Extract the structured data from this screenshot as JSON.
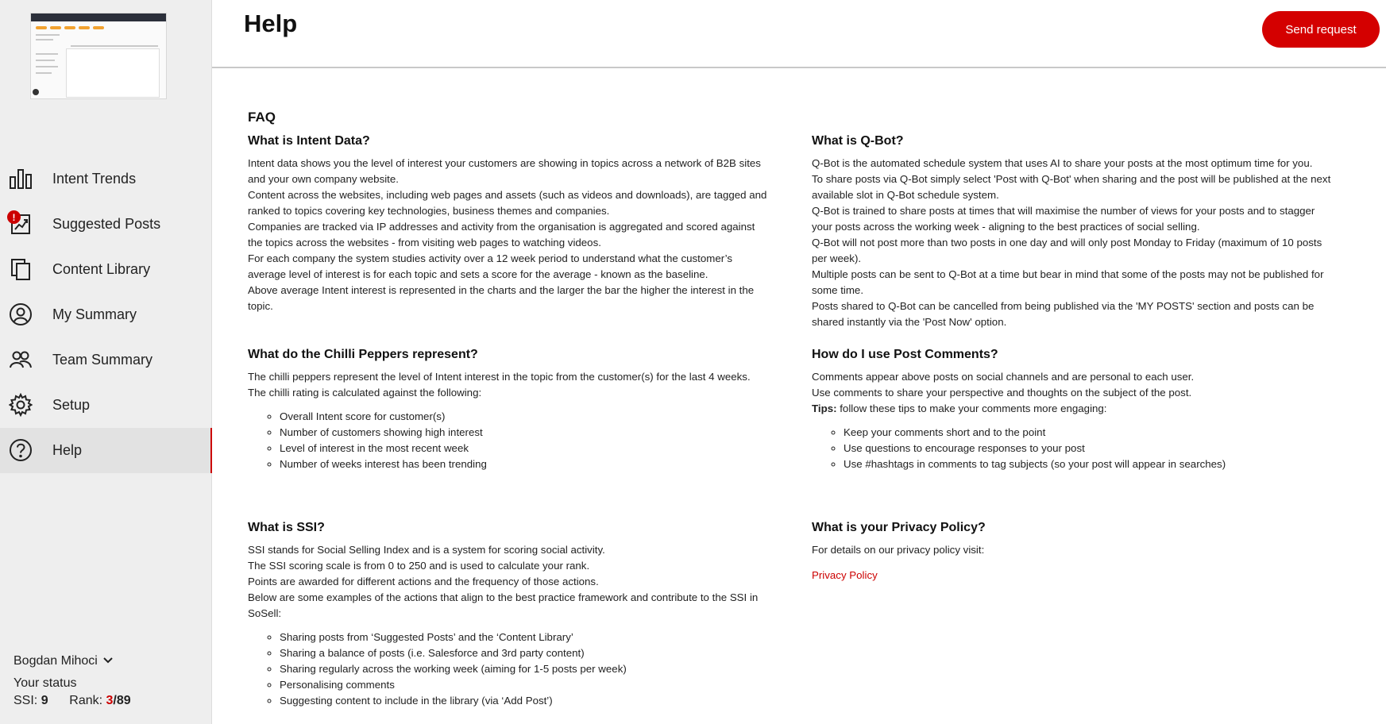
{
  "sidebar": {
    "items": [
      {
        "label": "Intent Trends",
        "icon": "bar-chart-icon"
      },
      {
        "label": "Suggested Posts",
        "icon": "trending-chart-icon",
        "badge": "!"
      },
      {
        "label": "Content Library",
        "icon": "copy-documents-icon"
      },
      {
        "label": "My Summary",
        "icon": "user-circle-icon"
      },
      {
        "label": "Team Summary",
        "icon": "users-icon"
      },
      {
        "label": "Setup",
        "icon": "gear-icon"
      },
      {
        "label": "Help",
        "icon": "help-circle-icon",
        "active": true
      }
    ],
    "user": {
      "name": "Bogdan Mihoci",
      "status_label": "Your status",
      "ssi_label": "SSI:",
      "ssi_value": "9",
      "rank_label": "Rank:",
      "rank_current": "3",
      "rank_total": "/89"
    }
  },
  "header": {
    "title": "Help",
    "send_request_label": "Send request"
  },
  "faq": {
    "title": "FAQ",
    "intent": {
      "heading": "What is Intent Data?",
      "paragraphs": [
        "Intent data shows you the level of interest your customers are showing in topics across a network of B2B sites and your own company website.",
        "Content across the websites, including web pages and assets (such as videos and downloads), are tagged and ranked to topics covering key technologies, business themes and companies.",
        "Companies are tracked via IP addresses and activity from the organisation is aggregated and scored against the topics across the websites - from visiting web pages to watching videos.",
        "For each company the system studies activity over a 12 week period to understand what the customer’s average level of interest is for each topic and sets a score for the average - known as the baseline.",
        "Above average Intent interest is represented in the charts and the larger the bar the higher the interest in the topic."
      ]
    },
    "qbot": {
      "heading": "What is Q-Bot?",
      "paragraphs": [
        "Q-Bot is the automated schedule system that uses AI to share your posts at the most optimum time for you.",
        "To share posts via Q-Bot simply select 'Post with Q-Bot' when sharing and the post will be published at the next available slot in Q-Bot schedule system.",
        "Q-Bot is trained to share posts at times that will maximise the number of views for your posts and to stagger your posts across the working week - aligning to the best practices of social selling.",
        "Q-Bot will not post more than two posts in one day and will only post Monday to Friday (maximum of 10 posts per week).",
        "Multiple posts can be sent to Q-Bot at a time but bear in mind that some of the posts may not be published for some time.",
        "Posts shared to Q-Bot can be cancelled from being published via the 'MY POSTS' section and posts can be shared instantly via the 'Post Now' option."
      ]
    },
    "chilli": {
      "heading": "What do the Chilli Peppers represent?",
      "paragraphs": [
        "The chilli peppers represent the level of Intent interest in the topic from the customer(s) for the last 4 weeks.",
        "The chilli rating is calculated against the following:"
      ],
      "bullets": [
        "Overall Intent score for customer(s)",
        "Number of customers showing high interest",
        "Level of interest in the most recent week",
        "Number of weeks interest has been trending"
      ]
    },
    "comments": {
      "heading": "How do I use Post Comments?",
      "paragraphs": [
        "Comments appear above posts on social channels and are personal to each user.",
        "Use comments to share your perspective and thoughts on the subject of the post."
      ],
      "tips_label": "Tips:",
      "tips_text": " follow these tips to make your comments more engaging:",
      "bullets": [
        "Keep your comments short and to the point",
        "Use questions to encourage responses to your post",
        "Use #hashtags in comments to tag subjects (so your post will appear in searches)"
      ]
    },
    "ssi": {
      "heading": "What is SSI?",
      "paragraphs": [
        "SSI stands for Social Selling Index and is a system for scoring social activity.",
        "The SSI scoring scale is from 0 to 250 and is used to calculate your rank.",
        "Points are awarded for different actions and the frequency of those actions.",
        "Below are some examples of the actions that align to the best practice framework and contribute to the SSI in SoSell:"
      ],
      "bullets": [
        "Sharing posts from ‘Suggested Posts’ and the ‘Content Library’",
        "Sharing a balance of posts (i.e. Salesforce and 3rd party content)",
        "Sharing regularly across the working week (aiming for 1-5 posts per week)",
        "Personalising comments",
        "Suggesting content to include in the library (via ‘Add Post’)"
      ]
    },
    "privacy": {
      "heading": "What is your Privacy Policy?",
      "text": "For details on our privacy policy visit:",
      "link_label": "Privacy Policy"
    }
  }
}
